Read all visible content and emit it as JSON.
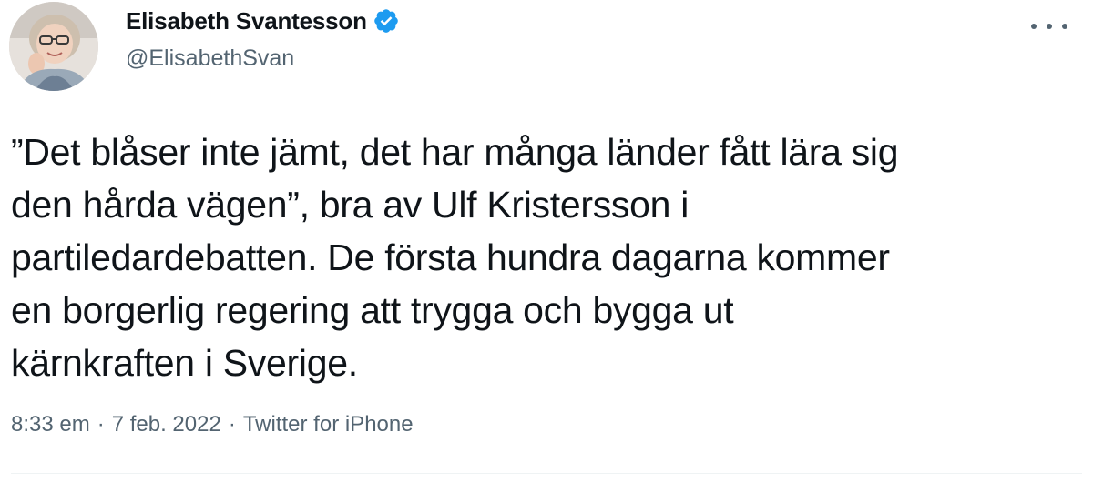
{
  "author": {
    "display_name": "Elisabeth Svantesson",
    "handle": "@ElisabethSvan",
    "verified": true,
    "avatar_icon": "profile-photo"
  },
  "tweet": {
    "text": "”Det blåser inte jämt, det har många länder fått lära sig\nden hårda vägen”, bra av Ulf Kristersson i\npartiledardebatten. De första hundra dagarna kommer\nen borgerlig regering att trygga och bygga ut\nkärnkraften i Sverige."
  },
  "meta": {
    "time": "8:33 em",
    "separator": "·",
    "date": "7 feb. 2022",
    "source": "Twitter for iPhone"
  },
  "icons": {
    "more": "more-icon",
    "verified": "verified-badge-icon"
  },
  "colors": {
    "text": "#0f1419",
    "secondary": "#536471",
    "verified": "#1d9bf0",
    "divider": "#eff3f4"
  }
}
